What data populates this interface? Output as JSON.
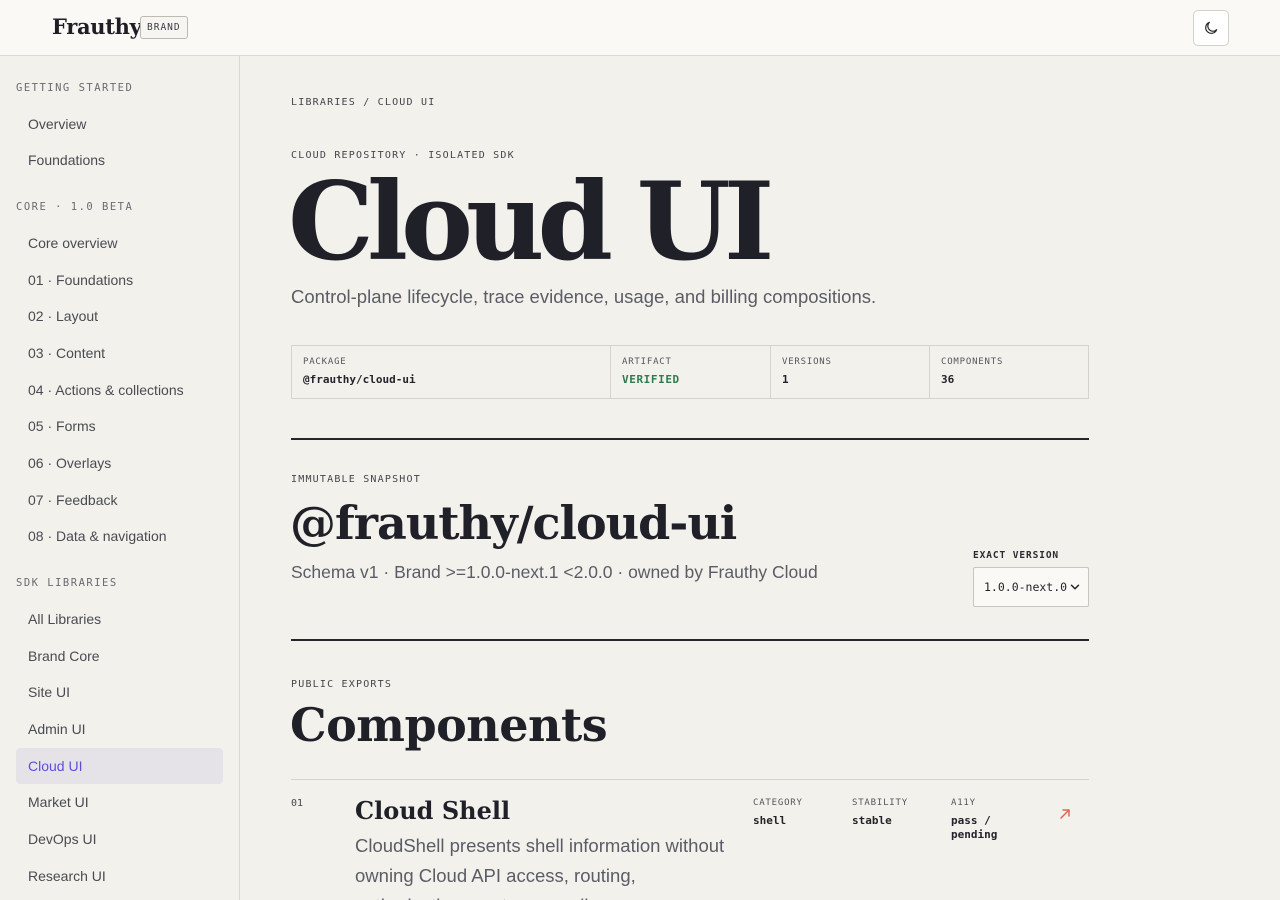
{
  "header": {
    "brand_name": "Frauthy",
    "brand_badge": "BRAND",
    "theme_toggle_icon": "moon-icon"
  },
  "sidebar": {
    "sections": [
      {
        "heading": "GETTING STARTED",
        "items": [
          "Overview",
          "Foundations"
        ]
      },
      {
        "heading": "CORE · 1.0 BETA",
        "items": [
          "Core overview",
          "01 · Foundations",
          "02 · Layout",
          "03 · Content",
          "04 · Actions & collections",
          "05 · Forms",
          "06 · Overlays",
          "07 · Feedback",
          "08 · Data & navigation"
        ]
      },
      {
        "heading": "SDK LIBRARIES",
        "items": [
          "All Libraries",
          "Brand Core",
          "Site UI",
          "Admin UI",
          "Cloud UI",
          "Market UI",
          "DevOps UI",
          "Research UI"
        ]
      }
    ],
    "active_item": "Cloud UI",
    "active_color": "#5b4fd6"
  },
  "breadcrumb": "LIBRARIES / CLOUD UI",
  "hero": {
    "eyebrow": "CLOUD REPOSITORY · ISOLATED SDK",
    "title": "Cloud UI",
    "subtitle": "Control-plane lifecycle, trace evidence, usage, and billing compositions."
  },
  "meta": {
    "package_label": "PACKAGE",
    "package_value": "@frauthy/cloud-ui",
    "artifact_label": "ARTIFACT",
    "artifact_value": "VERIFIED",
    "versions_label": "VERSIONS",
    "versions_value": "1",
    "components_label": "COMPONENTS",
    "components_value": "36",
    "verified_color": "#2f7b4e"
  },
  "snapshot": {
    "eyebrow": "IMMUTABLE SNAPSHOT",
    "title": "@frauthy/cloud-ui",
    "subtitle": "Schema v1 · Brand >=1.0.0-next.1 <2.0.0 · owned by Frauthy Cloud",
    "version_label": "EXACT VERSION",
    "version_selected": "1.0.0-next.0"
  },
  "exports": {
    "eyebrow": "PUBLIC EXPORTS",
    "title": "Components",
    "rows": [
      {
        "number": "01",
        "name": "Cloud Shell",
        "description": "CloudShell presents shell information without owning Cloud API access, routing, authorization, or storage policy.",
        "category_label": "CATEGORY",
        "category": "shell",
        "stability_label": "STABILITY",
        "stability": "stable",
        "a11y_label": "A11Y",
        "a11y": "pass / pending",
        "link_icon": "arrow-up-right-icon"
      }
    ]
  },
  "accent_link_color": "#e0644f"
}
